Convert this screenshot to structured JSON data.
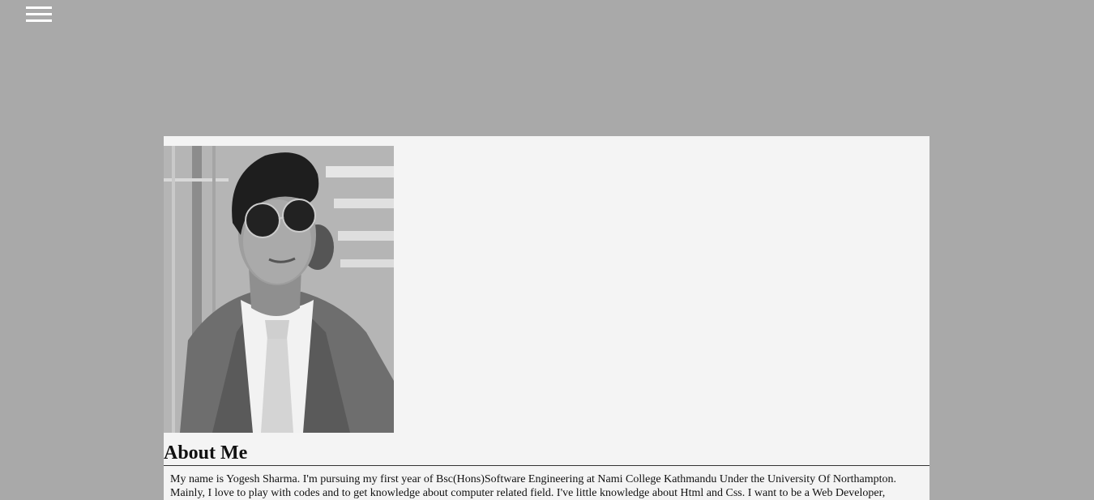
{
  "nav": {
    "menu_icon": "hamburger-menu-icon"
  },
  "about": {
    "photo_alt": "Portrait photo",
    "heading": "About Me",
    "paragraph": "My name is Yogesh Sharma. I'm pursuing my first year of Bsc(Hons)Software Engineering at Nami College Kathmandu Under the University Of Northampton. Mainly, I love to play with codes and to get knowledge about computer related field. I've little knowledge about Html and Css. I want to be a Web Developer,"
  },
  "colors": {
    "page_background": "#a9a9a9",
    "panel_background": "#f4f4f4",
    "menu_icon": "#ffffff"
  }
}
